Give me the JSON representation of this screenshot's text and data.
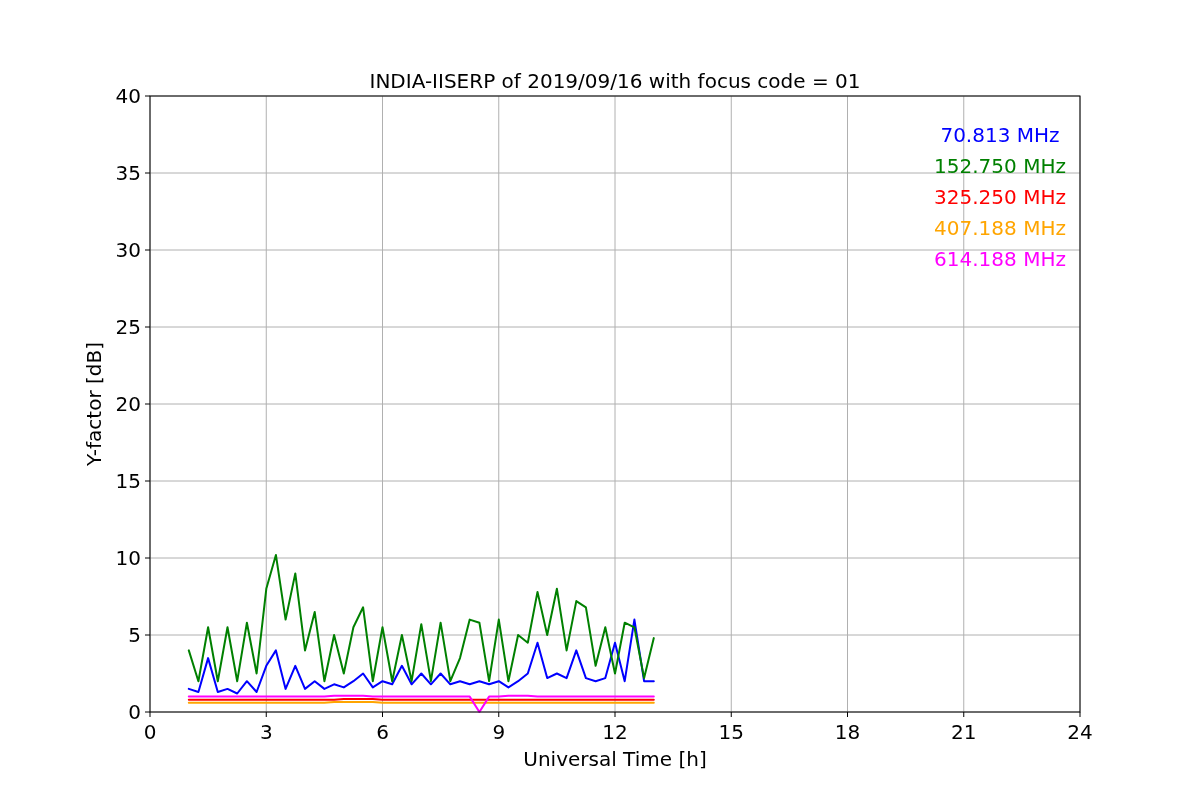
{
  "figure": {
    "chart_data": {
      "type": "line",
      "grid": true,
      "title": "INDIA-IISERP of 2019/09/16 with focus code = 01",
      "xlabel": "Universal Time [h]",
      "ylabel": "Y-factor [dB]",
      "xlim": [
        0,
        24
      ],
      "ylim": [
        0,
        40
      ],
      "xticks": [
        0,
        3,
        6,
        9,
        12,
        15,
        18,
        21,
        24
      ],
      "yticks": [
        0,
        5,
        10,
        15,
        20,
        25,
        30,
        35,
        40
      ],
      "x": [
        1,
        1.25,
        1.5,
        1.75,
        2,
        2.25,
        2.5,
        2.75,
        3,
        3.25,
        3.5,
        3.75,
        4,
        4.25,
        4.5,
        4.75,
        5,
        5.25,
        5.5,
        5.75,
        6,
        6.25,
        6.5,
        6.75,
        7,
        7.25,
        7.5,
        7.75,
        8,
        8.25,
        8.5,
        8.75,
        9,
        9.25,
        9.5,
        9.75,
        10,
        10.25,
        10.5,
        10.75,
        11,
        11.25,
        11.5,
        11.75,
        12,
        12.25,
        12.5,
        12.75,
        13
      ],
      "series": [
        {
          "name": "70.813 MHz",
          "color": "#0000ff",
          "values": [
            1.5,
            1.3,
            3.5,
            1.3,
            1.5,
            1.2,
            2.0,
            1.3,
            3.0,
            4.0,
            1.5,
            3.0,
            1.5,
            2.0,
            1.5,
            1.8,
            1.6,
            2.0,
            2.5,
            1.6,
            2.0,
            1.8,
            3.0,
            1.8,
            2.5,
            1.8,
            2.5,
            1.8,
            2.0,
            1.8,
            2.0,
            1.8,
            2.0,
            1.6,
            2.0,
            2.5,
            4.5,
            2.2,
            2.5,
            2.2,
            4.0,
            2.2,
            2.0,
            2.2,
            4.5,
            2.0,
            6.0,
            2.0,
            2.0
          ]
        },
        {
          "name": "152.750 MHz",
          "color": "#008000",
          "values": [
            4.0,
            2.0,
            5.5,
            2.0,
            5.5,
            2.0,
            5.8,
            2.5,
            8.0,
            10.2,
            6.0,
            9.0,
            4.0,
            6.5,
            2.0,
            5.0,
            2.5,
            5.5,
            6.8,
            2.0,
            5.5,
            2.0,
            5.0,
            2.0,
            5.7,
            2.0,
            5.8,
            2.0,
            3.5,
            6.0,
            5.8,
            2.0,
            6.0,
            2.0,
            5.0,
            4.5,
            7.8,
            5.0,
            8.0,
            4.0,
            7.2,
            6.8,
            3.0,
            5.5,
            2.5,
            5.8,
            5.5,
            2.2,
            4.8
          ]
        },
        {
          "name": "325.250 MHz",
          "color": "#ff0000",
          "values": [
            0.8,
            0.8,
            0.8,
            0.8,
            0.8,
            0.8,
            0.8,
            0.8,
            0.8,
            0.8,
            0.8,
            0.8,
            0.8,
            0.8,
            0.8,
            0.8,
            0.85,
            0.85,
            0.85,
            0.85,
            0.8,
            0.8,
            0.8,
            0.8,
            0.8,
            0.8,
            0.8,
            0.8,
            0.8,
            0.8,
            0.8,
            0.8,
            0.8,
            0.8,
            0.8,
            0.8,
            0.8,
            0.8,
            0.8,
            0.8,
            0.8,
            0.8,
            0.8,
            0.8,
            0.8,
            0.8,
            0.8,
            0.8,
            0.8
          ]
        },
        {
          "name": "407.188 MHz",
          "color": "#ffa500",
          "values": [
            0.6,
            0.6,
            0.6,
            0.6,
            0.6,
            0.6,
            0.6,
            0.6,
            0.6,
            0.6,
            0.6,
            0.6,
            0.6,
            0.6,
            0.6,
            0.65,
            0.65,
            0.65,
            0.65,
            0.65,
            0.6,
            0.6,
            0.6,
            0.6,
            0.6,
            0.6,
            0.6,
            0.6,
            0.6,
            0.6,
            0.6,
            0.6,
            0.6,
            0.6,
            0.6,
            0.6,
            0.6,
            0.6,
            0.6,
            0.6,
            0.6,
            0.6,
            0.6,
            0.6,
            0.6,
            0.6,
            0.6,
            0.6,
            0.6
          ]
        },
        {
          "name": "614.188 MHz",
          "color": "#ff00ff",
          "values": [
            1.0,
            1.0,
            1.0,
            1.0,
            1.0,
            1.0,
            1.0,
            1.0,
            1.0,
            1.0,
            1.0,
            1.0,
            1.0,
            1.0,
            1.0,
            1.05,
            1.05,
            1.05,
            1.05,
            1.0,
            1.0,
            1.0,
            1.0,
            1.0,
            1.0,
            1.0,
            1.0,
            1.0,
            1.0,
            1.0,
            0.0,
            1.0,
            1.0,
            1.05,
            1.05,
            1.05,
            1.0,
            1.0,
            1.0,
            1.0,
            1.0,
            1.0,
            1.0,
            1.0,
            1.0,
            1.0,
            1.0,
            1.0,
            1.0
          ]
        }
      ]
    }
  }
}
